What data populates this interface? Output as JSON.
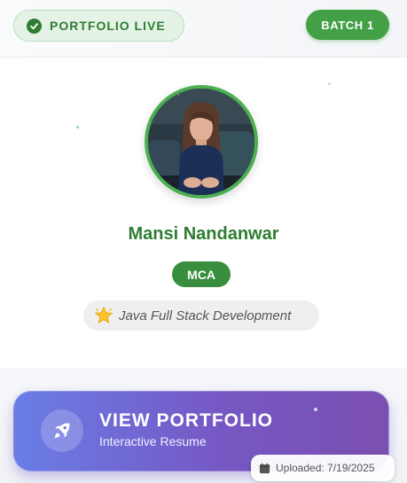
{
  "status": {
    "label": "PORTFOLIO LIVE",
    "icon": "check-circle-icon",
    "color": "#2e7d32"
  },
  "batch": {
    "label": "BATCH 1"
  },
  "profile": {
    "avatar_alt": "Profile photo",
    "name": "Mansi Nandanwar",
    "degree": "MCA",
    "track_icon": "star-icon",
    "track": "Java Full Stack Development"
  },
  "action": {
    "title": "VIEW PORTFOLIO",
    "subtitle": "Interactive Resume",
    "icon": "rocket-icon"
  },
  "upload": {
    "icon": "calendar-icon",
    "label": "Uploaded: 7/19/2025"
  },
  "colors": {
    "accent_green": "#43a047",
    "button_start": "#6a7de6",
    "button_end": "#7a4fb0"
  }
}
